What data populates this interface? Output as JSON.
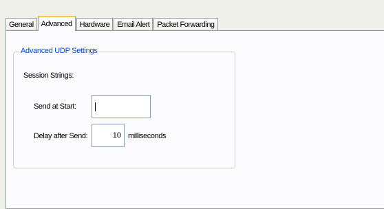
{
  "tabs": [
    "General",
    "Advanced",
    "Hardware",
    "Email Alert",
    "Packet Forwarding"
  ],
  "active_tab": "Advanced",
  "group": {
    "title": "Advanced UDP Settings",
    "section_label": "Session Strings:",
    "send_at_start": {
      "label": "Send at Start:",
      "value": ""
    },
    "delay_after_send": {
      "label": "Delay after Send:",
      "value": "10",
      "unit": "milliseconds"
    }
  }
}
